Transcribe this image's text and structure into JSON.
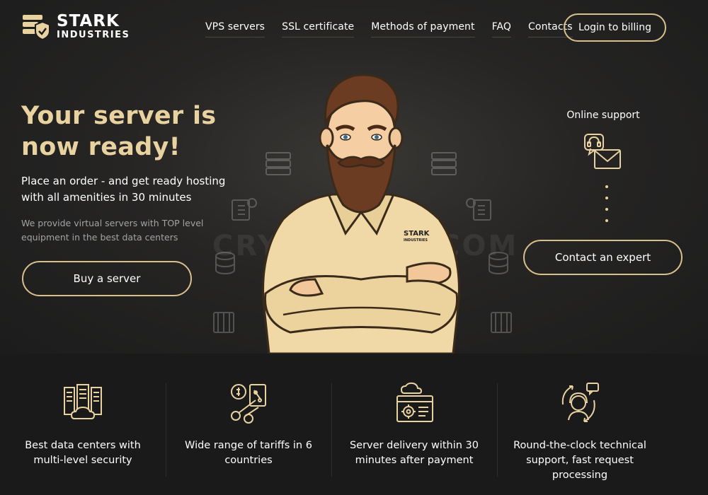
{
  "brand": {
    "name": "STARK",
    "subtitle": "INDUSTRIES",
    "shirt_logo_line1": "STARK",
    "shirt_logo_line2": "INDUSTRIES",
    "accent_color": "#d8c08a",
    "title_color": "#e8d2a0"
  },
  "nav": {
    "items": [
      {
        "label": "VPS servers"
      },
      {
        "label": "SSL certificate"
      },
      {
        "label": "Methods of payment"
      },
      {
        "label": "FAQ"
      },
      {
        "label": "Contacts"
      }
    ],
    "login_label": "Login to billing"
  },
  "hero": {
    "title": "Your server is now ready!",
    "subtitle": "Place an order - and get ready hosting with all amenities in 30 minutes",
    "description": "We provide virtual servers with TOP level equipment in the best data centers",
    "buy_label": "Buy a server"
  },
  "support": {
    "title": "Online support",
    "icon": "support-mail-icon",
    "contact_label": "Contact an expert"
  },
  "watermark": "CRYPTWARE.COM",
  "features": [
    {
      "icon": "data-center-cloud-icon",
      "label": "Best data centers with multi-level security"
    },
    {
      "icon": "tariff-scissors-icon",
      "label": "Wide range of tariffs in 6 countries"
    },
    {
      "icon": "server-delivery-gear-icon",
      "label": "Server delivery within 30 minutes after payment"
    },
    {
      "icon": "support-operator-icon",
      "label": "Round-the-clock technical support, fast request processing"
    }
  ]
}
